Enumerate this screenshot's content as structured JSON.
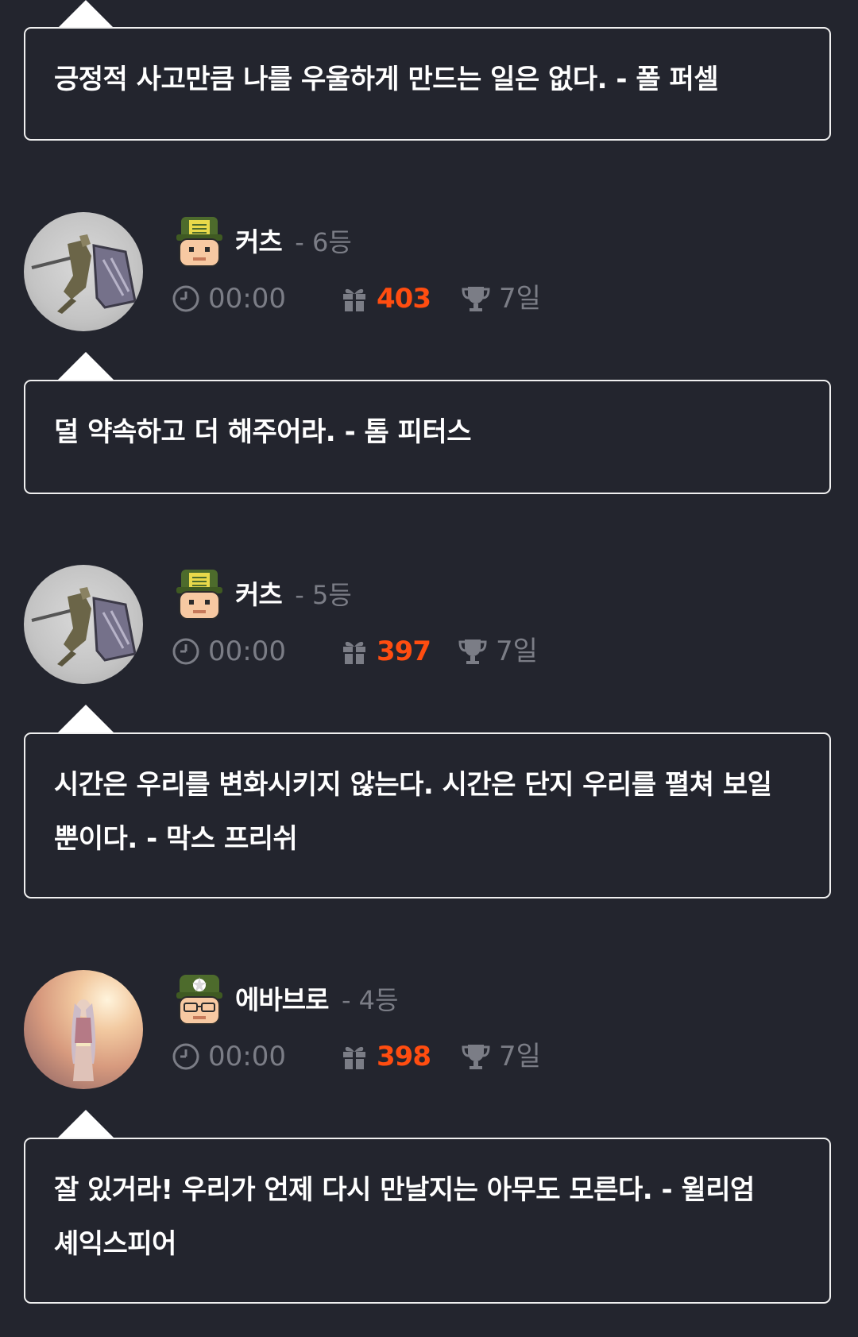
{
  "colors": {
    "background": "#23252e",
    "muted": "#7b7d86",
    "accent": "#ff4d10",
    "bubble_border": "#f0f0f0"
  },
  "top_quote": {
    "text": "긍정적 사고만큼 나를 우울하게 만드는 일은 없다. - 폴 퍼셀"
  },
  "posts": [
    {
      "avatar": "knight-avatar",
      "level_icon": "soldier-level-icon",
      "username": "커츠",
      "rank": "- 6등",
      "time": "00:00",
      "gift_count": "403",
      "trophy_label": "7일",
      "quote": "덜 약속하고 더 해주어라. - 톰 피터스"
    },
    {
      "avatar": "knight-avatar",
      "level_icon": "soldier-level-icon",
      "username": "커츠",
      "rank": "- 5등",
      "time": "00:00",
      "gift_count": "397",
      "trophy_label": "7일",
      "quote_line1": "시간은 우리를 변화시키지 않는다. 시간은 단지 우리를 펼쳐 보일",
      "quote_line2": "뿐이다. - 막스 프리쉬"
    },
    {
      "avatar": "sunset-avatar",
      "level_icon": "officer-level-icon",
      "username": "에바브로",
      "rank": "- 4등",
      "time": "00:00",
      "gift_count": "398",
      "trophy_label": "7일",
      "quote_line1": "잘 있거라! 우리가 언제 다시 만날지는 아무도 모른다. - 윌리엄",
      "quote_line2": "셰익스피어"
    }
  ]
}
